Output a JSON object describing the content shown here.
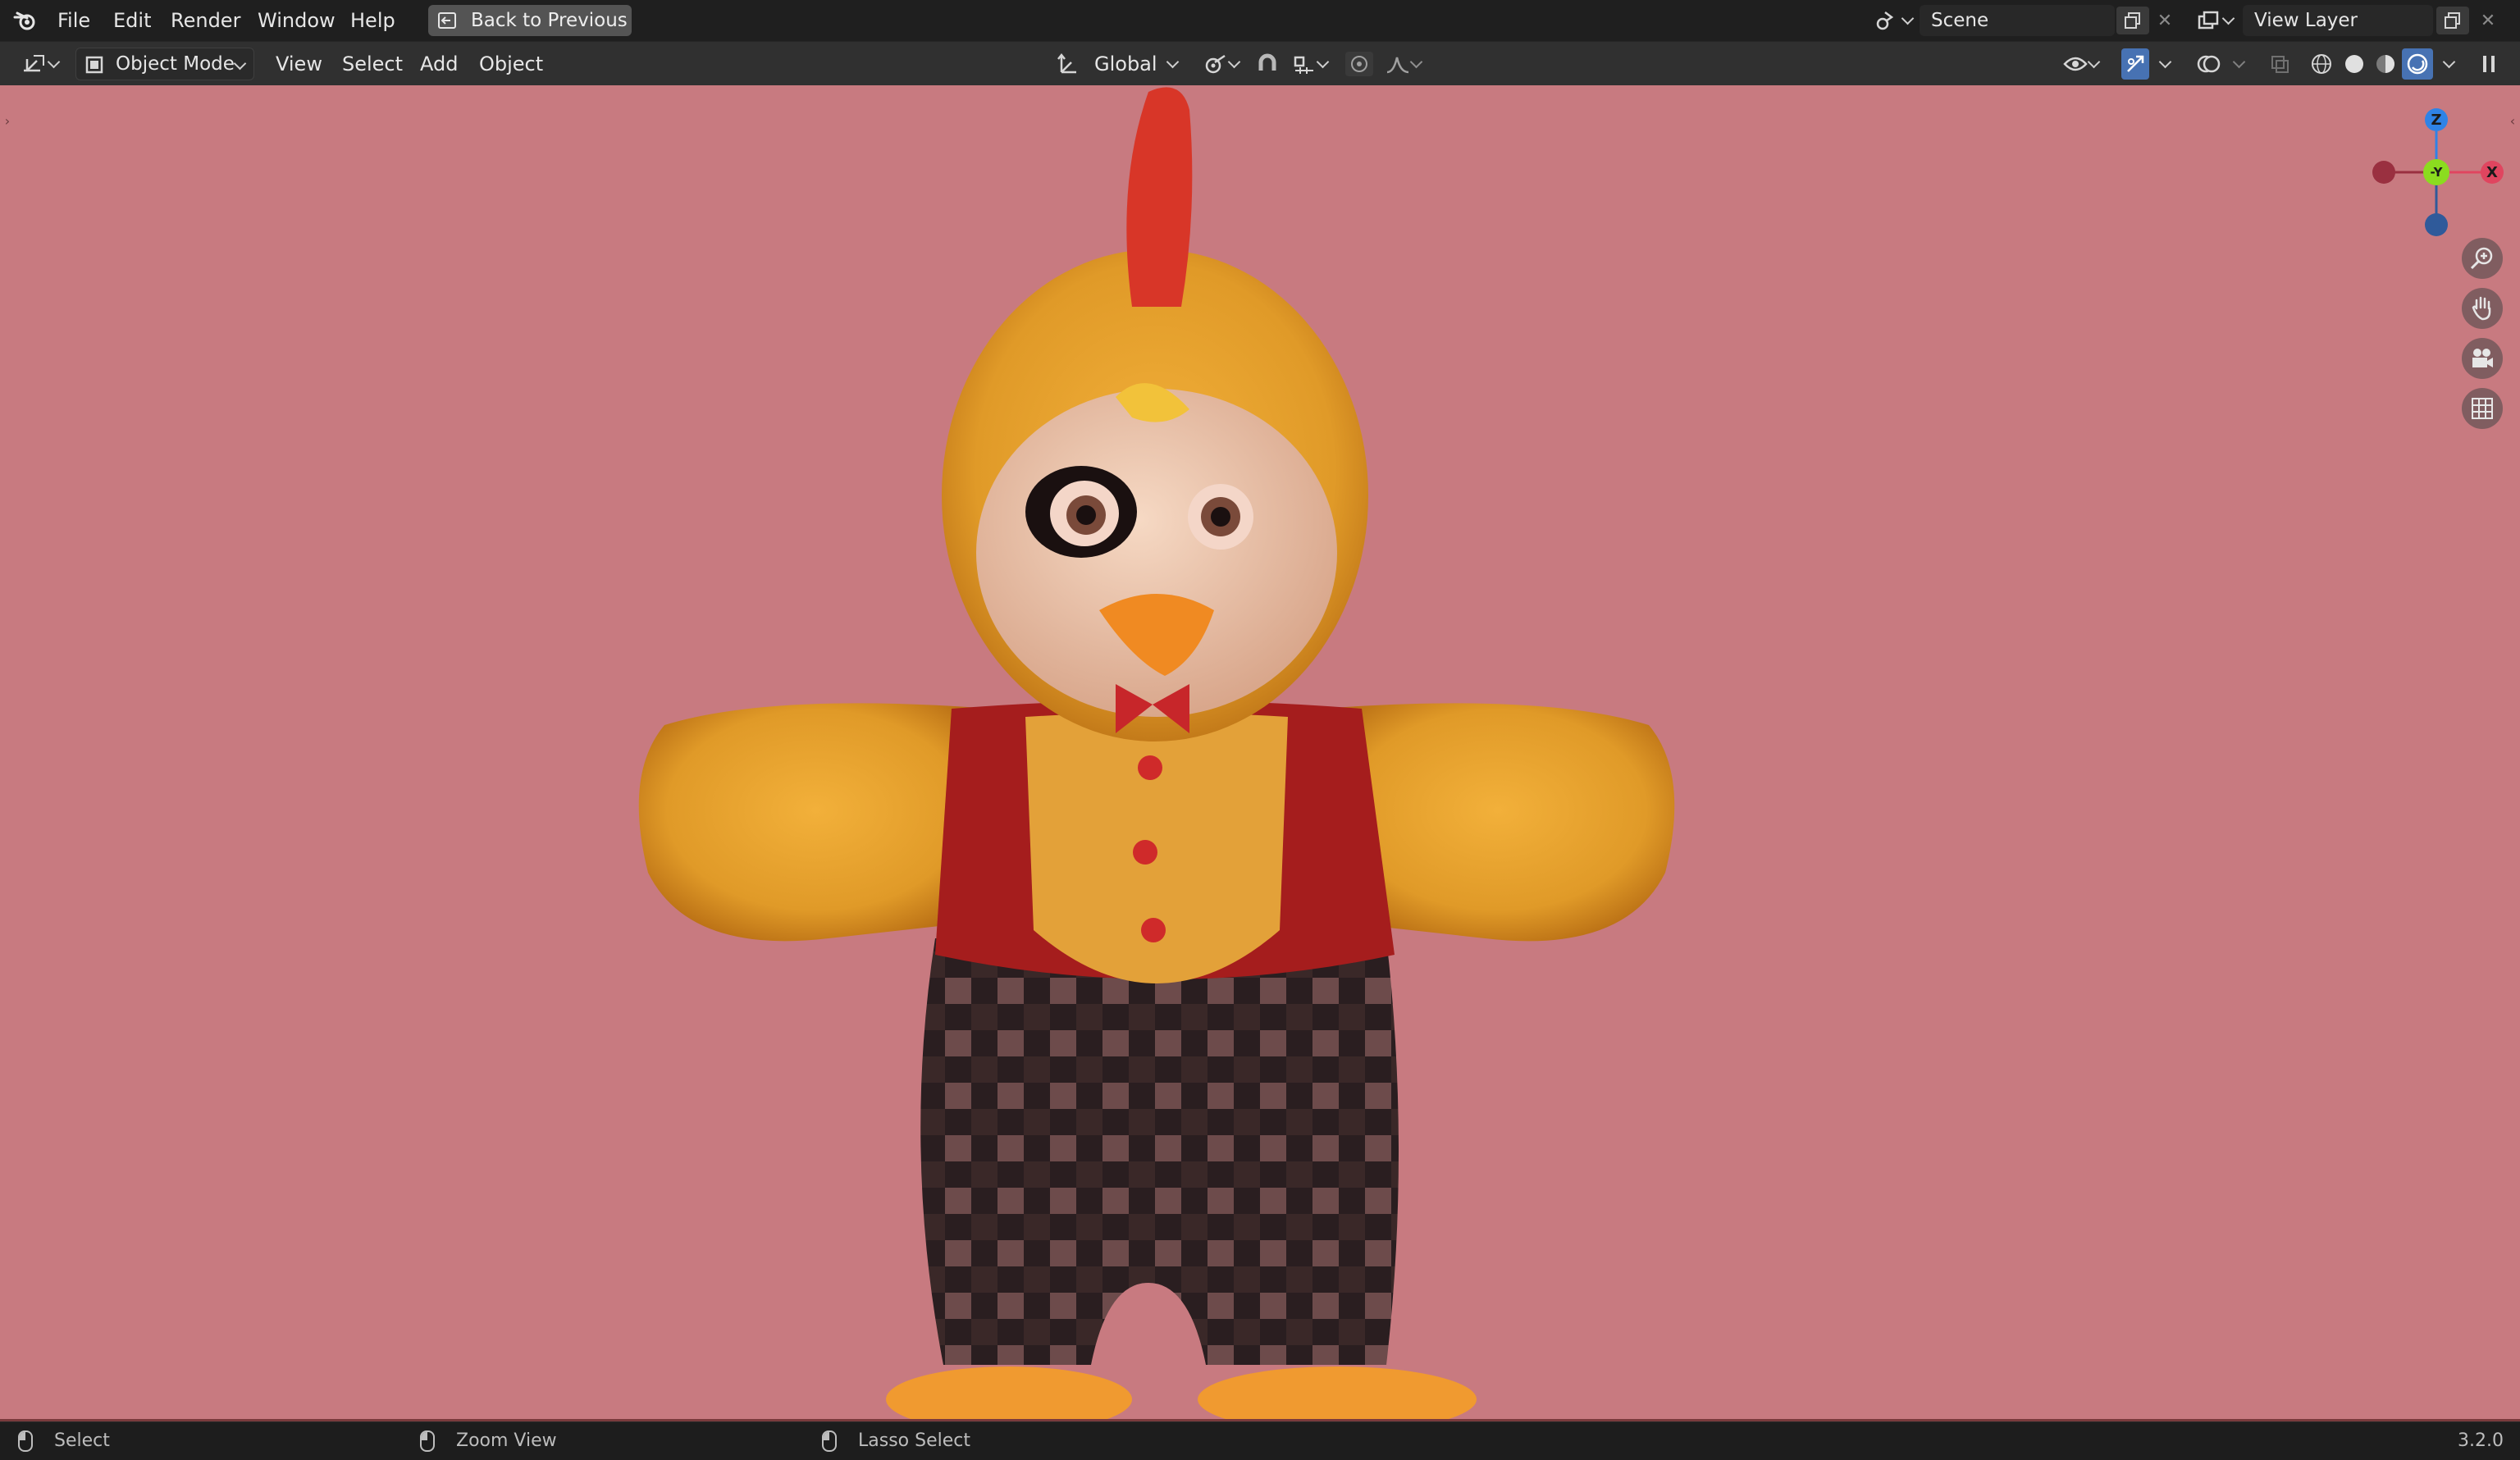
{
  "top_menu": {
    "items": [
      "File",
      "Edit",
      "Render",
      "Window",
      "Help"
    ],
    "back_button": "Back to Previous"
  },
  "scene": {
    "label": "Scene"
  },
  "view_layer": {
    "label": "View Layer"
  },
  "header": {
    "mode": "Object Mode",
    "menus": [
      "View",
      "Select",
      "Add",
      "Object"
    ],
    "orientation": "Global"
  },
  "gizmo": {
    "x": "X",
    "y": "-Y",
    "z": "Z"
  },
  "status": {
    "select": "Select",
    "zoom": "Zoom View",
    "lasso": "Lasso Select",
    "version": "3.2.0"
  },
  "icons": {
    "blender": "blender-logo-icon",
    "back": "back-arrow-icon",
    "editor_type": "3d-view-editor-icon",
    "object_mode": "object-mode-icon",
    "transform": "transform-orientation-icon",
    "pivot": "pivot-point-icon",
    "snap": "magnet-snap-icon",
    "proportional": "proportional-edit-icon",
    "visibility": "eye-icon",
    "gizmos": "gizmo-toggle-icon",
    "overlays": "overlays-icon",
    "shading": [
      "wireframe-shading-icon",
      "solid-shading-icon",
      "material-shading-icon",
      "rendered-shading-icon"
    ],
    "nav": [
      "zoom-icon",
      "hand-pan-icon",
      "camera-icon",
      "grid-ortho-icon"
    ]
  },
  "colors": {
    "viewport_bg": "#c87a80",
    "accent_blue": "#4772b3",
    "axis_x": "#e0455f",
    "axis_y": "#8bdc1f",
    "axis_z": "#2f83e6"
  }
}
